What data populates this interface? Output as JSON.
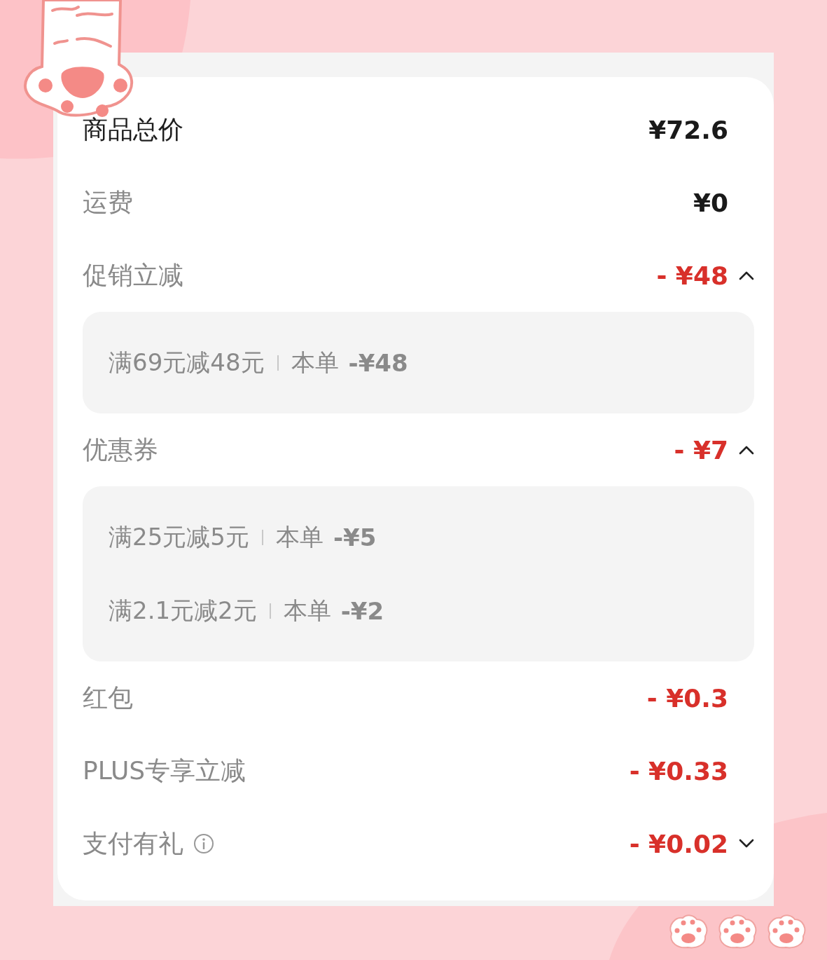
{
  "rows": [
    {
      "kind": "total",
      "label": "商品总价",
      "value": "¥72.6"
    },
    {
      "kind": "plain",
      "label": "运费",
      "value": "¥0"
    },
    {
      "kind": "discount",
      "label": "促销立减",
      "value": "- ¥48",
      "expanded": true,
      "details": [
        {
          "condition": "满69元减48元",
          "label": "本单",
          "amount": "-¥48"
        }
      ]
    },
    {
      "kind": "discount",
      "label": "优惠券",
      "value": "- ¥7",
      "expanded": true,
      "details": [
        {
          "condition": "满25元减5元",
          "label": "本单",
          "amount": "-¥5"
        },
        {
          "condition": "满2.1元减2元",
          "label": "本单",
          "amount": "-¥2"
        }
      ]
    },
    {
      "kind": "discount",
      "label": "红包",
      "value": "- ¥0.3"
    },
    {
      "kind": "discount",
      "label": "PLUS专享立减",
      "value": "- ¥0.33"
    },
    {
      "kind": "discount",
      "label": "支付有礼",
      "value": "- ¥0.02",
      "info": true,
      "expanded": false
    }
  ]
}
